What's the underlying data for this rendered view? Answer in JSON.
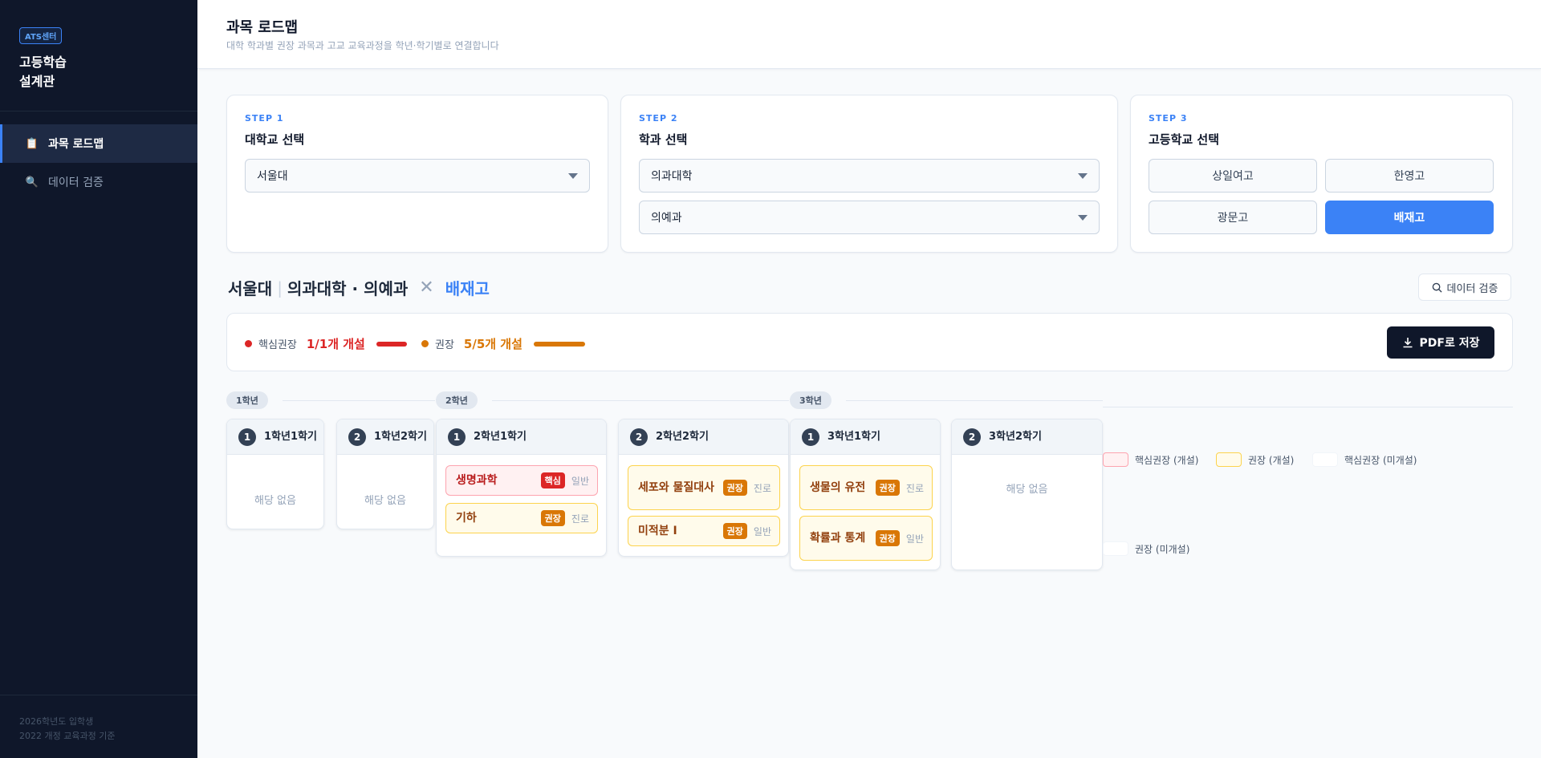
{
  "sidebar": {
    "badge": "ATS센터",
    "brand": "고등학습\n설계관",
    "items": [
      {
        "label": "과목 로드맵",
        "icon": "📋",
        "active": true
      },
      {
        "label": "데이터 검증",
        "icon": "🔍",
        "active": false
      }
    ],
    "footer": [
      "2026학년도 입학생",
      "2022 개정 교육과정 기준"
    ]
  },
  "header": {
    "title": "과목 로드맵",
    "subtitle": "대학 학과별 권장 과목과 고교 교육과정을 학년·학기별로 연결합니다"
  },
  "steps": [
    {
      "step": "STEP 1",
      "title": "대학교 선택",
      "selects": [
        "서울대"
      ]
    },
    {
      "step": "STEP 2",
      "title": "학과 선택",
      "selects": [
        "의과대학",
        "의예과"
      ]
    },
    {
      "step": "STEP 3",
      "title": "고등학교 선택",
      "schools": [
        "상일여고",
        "한영고",
        "광문고",
        "배재고"
      ],
      "selected_school": "배재고"
    }
  ],
  "selection": {
    "university": "서울대",
    "separator": "|",
    "department": "의과대학 · 의예과",
    "times": "✕",
    "school": "배재고",
    "verify_button": "데이터 검증"
  },
  "stats": {
    "core": {
      "label": "핵심권장",
      "value": "1/1개 개설",
      "color": "#dc2626",
      "ratio": 1.0
    },
    "recommended": {
      "label": "권장",
      "value": "5/5개 개설",
      "color": "#d97706",
      "ratio": 1.0
    },
    "pdf_button": "PDF로 저장"
  },
  "timeline": {
    "grades": [
      "1학년",
      "2학년",
      "3학년"
    ],
    "semesters": [
      {
        "num": "1",
        "title": "1학년1학기",
        "courses": [],
        "empty": "해당 없음"
      },
      {
        "num": "2",
        "title": "1학년2학기",
        "courses": [],
        "empty": "해당 없음"
      },
      {
        "num": "1",
        "title": "2학년1학기",
        "courses": [
          {
            "name": "생명과학",
            "tag": "핵심",
            "kind": "core",
            "type": "일반"
          },
          {
            "name": "기하",
            "tag": "권장",
            "kind": "rec",
            "type": "진로"
          }
        ]
      },
      {
        "num": "2",
        "title": "2학년2학기",
        "courses": [
          {
            "name": "세포와 물질대사",
            "tag": "권장",
            "kind": "rec",
            "type": "진로"
          },
          {
            "name": "미적분 Ⅰ",
            "tag": "권장",
            "kind": "rec",
            "type": "일반"
          }
        ]
      },
      {
        "num": "1",
        "title": "3학년1학기",
        "courses": [
          {
            "name": "생물의 유전",
            "tag": "권장",
            "kind": "rec",
            "type": "진로"
          },
          {
            "name": "확률과 통계",
            "tag": "권장",
            "kind": "rec",
            "type": "일반"
          }
        ]
      },
      {
        "num": "2",
        "title": "3학년2학기",
        "courses": [],
        "empty": "해당 없음"
      }
    ]
  },
  "legend": [
    {
      "label": "핵심권장 (개설)",
      "color": "#fff1f2",
      "border": "#fda4af"
    },
    {
      "label": "권장 (개설)",
      "color": "#fffbeb",
      "border": "#fcd34d"
    },
    {
      "label": "핵심권장 (미개설)",
      "color": "#ffffff",
      "border": "#f8fafc"
    },
    {
      "label": "권장 (미개설)",
      "color": "#ffffff",
      "border": "#f8fafc"
    }
  ]
}
